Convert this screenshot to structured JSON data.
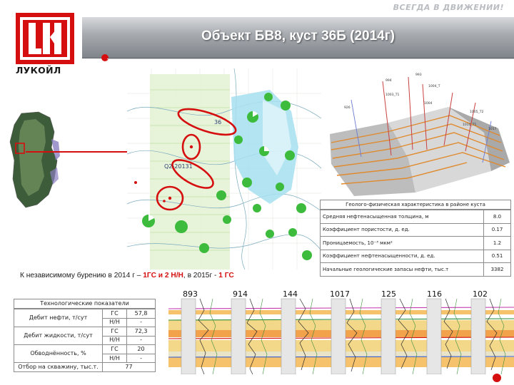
{
  "header": {
    "slogan": "ВСЕГДА В ДВИЖЕНИИ!",
    "brand": "ЛУКОЙЛ",
    "title": "Объект БВ8, куст 36Б (2014г)",
    "colors": {
      "brand_red": "#d50f0f",
      "band_gray": "#8a8f95"
    }
  },
  "map": {
    "label_36": "36",
    "label_well": "Q2-20131"
  },
  "model3d": {
    "labels": [
      "993",
      "994",
      "1004_T",
      "1003_T1",
      "1004",
      "926",
      "1005_T2",
      "1010_T1",
      "1017"
    ]
  },
  "geology": {
    "title": "Геолого-физическая характеристика в районе куста",
    "rows": [
      {
        "label": "Средняя нефтенасыщенная толщина, м",
        "value": "8.0"
      },
      {
        "label": "Коэффициент пористости, д. ед.",
        "value": "0.17"
      },
      {
        "label": "Проницаемость, 10⁻³ мкм²",
        "value": "1.2"
      },
      {
        "label": "Коэффициент нефтенасыщенности, д. ед.",
        "value": "0.51"
      },
      {
        "label": "Начальные геологические запасы нефти, тыс.т",
        "value": "3382"
      }
    ]
  },
  "note": {
    "prefix": "К независимому бурению в 2014 г – ",
    "plan_2014": "1ГС и 2 Н/Н",
    "middle": ", в 2015г - ",
    "plan_2015": "1 ГС"
  },
  "tech": {
    "title": "Технологические показатели",
    "oil_label": "Дебит нефти, т/сут",
    "liquid_label": "Дебит жидкости, т/сут",
    "water_label": "Обводнённость, %",
    "reserves_label": "Отбор на скважину, тыс.т.",
    "gs": "ГС",
    "nn": "Н/Н",
    "oil_gs": "57,8",
    "oil_nn": "-",
    "liquid_gs": "72,3",
    "liquid_nn": "-",
    "water_gs": "20",
    "water_nn": "-",
    "reserves": "77"
  },
  "logs": {
    "wells": [
      "893",
      "914",
      "144",
      "1017",
      "125",
      "116",
      "102"
    ]
  }
}
